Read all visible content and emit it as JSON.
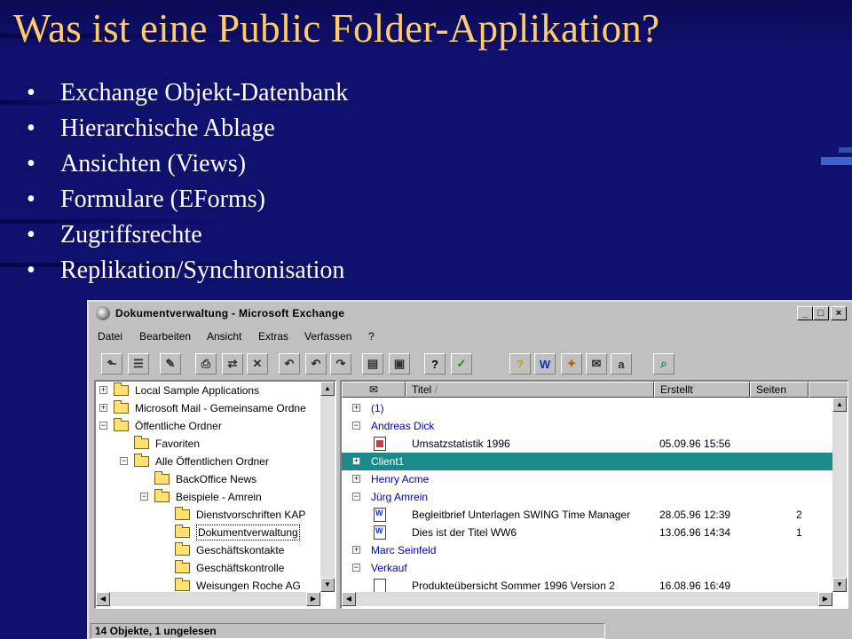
{
  "slide": {
    "title": "Was ist eine Public Folder-Applikation?",
    "bullets": [
      "Exchange Objekt-Datenbank",
      "Hierarchische Ablage",
      "Ansichten (Views)",
      "Formulare (EForms)",
      "Zugriffsrechte",
      "Replikation/Synchronisation"
    ],
    "bullet_char": "•",
    "colors": {
      "background": "#10106e",
      "title": "#ffcc66",
      "text": "#ffffff"
    }
  },
  "window": {
    "title": "Dokumentverwaltung - Microsoft Exchange",
    "controls": {
      "minimize": "_",
      "maximize": "□",
      "close": "×"
    },
    "menu": [
      "Datei",
      "Bearbeiten",
      "Ansicht",
      "Extras",
      "Verfassen",
      "?"
    ],
    "toolbar_icons": [
      "folder-up-icon",
      "folder-list-icon",
      "new-message-icon",
      "print-icon",
      "move-icon",
      "delete-icon",
      "reply-icon",
      "reply-all-icon",
      "forward-icon",
      "address-book-icon",
      "inbox-icon",
      "help-icon",
      "approve-icon",
      "form-icon",
      "word-icon",
      "new-post-icon",
      "mail-icon",
      "spelling-icon",
      "find-icon"
    ],
    "folder_tree": [
      {
        "label": "Local Sample Applications",
        "toggle": "+"
      },
      {
        "label": "Microsoft Mail - Gemeinsame Ordne",
        "toggle": "+"
      },
      {
        "label": "Öffentliche Ordner",
        "toggle": "−"
      },
      {
        "label": "Favoriten",
        "toggle": ""
      },
      {
        "label": "Alle Öffentlichen Ordner",
        "toggle": "−"
      },
      {
        "label": "BackOffice News",
        "toggle": ""
      },
      {
        "label": "Beispiele - Amrein",
        "toggle": "−"
      },
      {
        "label": "Dienstvorschriften KAP",
        "toggle": ""
      },
      {
        "label": "Dokumentverwaltung",
        "toggle": ""
      },
      {
        "label": "Geschäftskontakte",
        "toggle": ""
      },
      {
        "label": "Geschäftskontrolle",
        "toggle": ""
      },
      {
        "label": "Weisungen Roche AG",
        "toggle": ""
      }
    ],
    "columns": {
      "icon": "✉",
      "title": "Titel",
      "sort": "/",
      "created": "Erstellt",
      "pages": "Seiten"
    },
    "rows": [
      {
        "type": "group",
        "toggle": "+",
        "label": "(1)"
      },
      {
        "type": "group",
        "toggle": "−",
        "label": "Andreas Dick"
      },
      {
        "type": "item",
        "icon": "form",
        "title": "Umsatzstatistik 1996",
        "created": "05.09.96 15:56",
        "pages": ""
      },
      {
        "type": "group",
        "toggle": "+",
        "label": "Client1",
        "selected": true
      },
      {
        "type": "group",
        "toggle": "+",
        "label": "Henry Acme"
      },
      {
        "type": "group",
        "toggle": "−",
        "label": "Jürg Amrein"
      },
      {
        "type": "item",
        "icon": "word",
        "title": "Begleitbrief Unterlagen SWING Time Manager",
        "created": "28.05.96 12:39",
        "pages": "2"
      },
      {
        "type": "item",
        "icon": "word",
        "title": "Dies ist der Titel WW6",
        "created": "13.06.96 14:34",
        "pages": "1"
      },
      {
        "type": "group",
        "toggle": "+",
        "label": "Marc Seinfeld"
      },
      {
        "type": "group",
        "toggle": "−",
        "label": "Verkauf"
      },
      {
        "type": "item",
        "icon": "doc",
        "title": "Produkteübersicht Sommer 1996 Version 2",
        "created": "16.08.96 16:49",
        "pages": ""
      }
    ],
    "status": "14 Objekte, 1 ungelesen",
    "colors": {
      "chrome": "#c0c0c0",
      "group_text": "#0000c0",
      "selection": "#1a8a8a"
    }
  }
}
